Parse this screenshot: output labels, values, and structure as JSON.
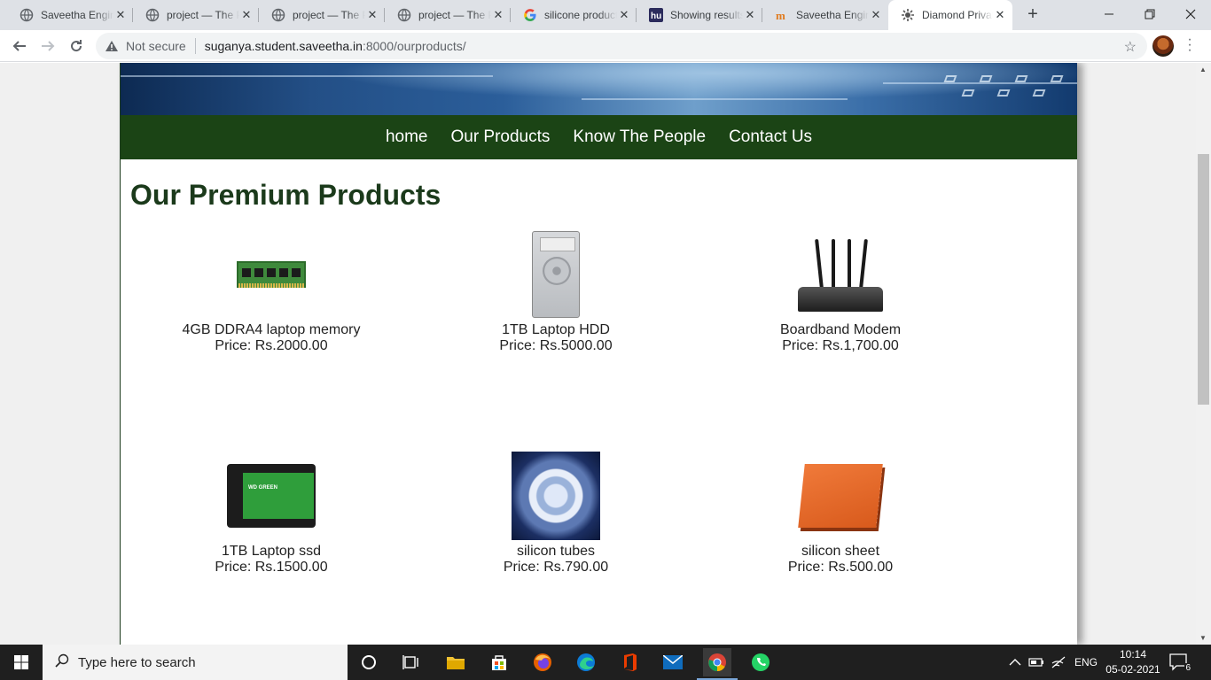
{
  "browser": {
    "tabs": [
      {
        "title": "Saveetha Engineering College",
        "icon": "globe-icon"
      },
      {
        "title": "project — The Parts Place",
        "icon": "globe-icon"
      },
      {
        "title": "project — The Parts Place",
        "icon": "globe-icon"
      },
      {
        "title": "project — The Parts Place",
        "icon": "globe-icon"
      },
      {
        "title": "silicone products - Google Search",
        "icon": "google-icon"
      },
      {
        "title": "Showing results",
        "icon": "hu-icon"
      },
      {
        "title": "Saveetha Engineering College",
        "icon": "m-icon"
      },
      {
        "title": "Diamond Private Limited",
        "icon": "gear-icon",
        "active": true
      }
    ],
    "security_label": "Not secure",
    "url_host": "suganya.student.saveetha.in",
    "url_path": ":8000/ourproducts/"
  },
  "site": {
    "nav": [
      "home",
      "Our Products",
      "Know The People",
      "Contact Us"
    ],
    "heading": "Our Premium Products",
    "products": [
      {
        "name": "4GB DDRA4 laptop memory",
        "price": "Price: Rs.2000.00",
        "image": "ram"
      },
      {
        "name": "1TB Laptop HDD",
        "price": "Price: Rs.5000.00",
        "image": "hdd"
      },
      {
        "name": "Boardband Modem",
        "price": "Price: Rs.1,700.00",
        "image": "modem"
      },
      {
        "name": "1TB Laptop ssd",
        "price": "Price: Rs.1500.00",
        "image": "ssd"
      },
      {
        "name": "silicon tubes",
        "price": "Price: Rs.790.00",
        "image": "tubes"
      },
      {
        "name": "silicon sheet",
        "price": "Price: Rs.500.00",
        "image": "sheet"
      }
    ]
  },
  "taskbar": {
    "search_placeholder": "Type here to search",
    "language": "ENG",
    "time": "10:14",
    "date": "05-02-2021",
    "notifications": "6"
  },
  "colors": {
    "nav_bg": "#1b4415",
    "heading": "#1b3a1b",
    "tabstrip": "#dee1e6",
    "taskbar": "#1f1f1f"
  }
}
